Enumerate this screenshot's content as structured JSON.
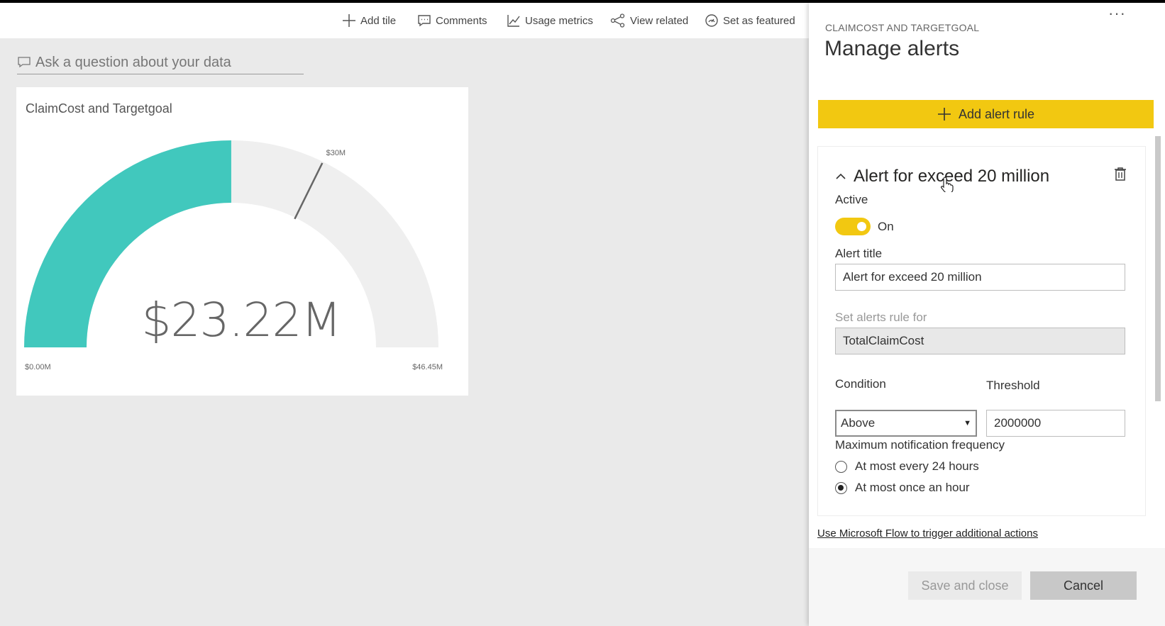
{
  "toolbar": {
    "items": [
      {
        "label": "Add tile",
        "icon": "plus-icon"
      },
      {
        "label": "Comments",
        "icon": "comment-icon"
      },
      {
        "label": "Usage metrics",
        "icon": "chart-line-icon"
      },
      {
        "label": "View related",
        "icon": "share-nodes-icon"
      },
      {
        "label": "Set as featured",
        "icon": "featured-icon"
      }
    ]
  },
  "qna": {
    "placeholder": "Ask a question about your data"
  },
  "tile": {
    "title": "ClaimCost and Targetgoal",
    "value_label": "$23.22M",
    "min_label": "$0.00M",
    "max_label": "$46.45M",
    "target_label": "$30M"
  },
  "chart_data": {
    "type": "gauge",
    "title": "ClaimCost and Targetgoal",
    "value": 23.22,
    "min": 0,
    "max": 46.45,
    "target": 30,
    "unit": "$M",
    "fill_color": "#41c8bd",
    "track_color": "#efefef"
  },
  "panel": {
    "more_label": "···",
    "subtitle": "CLAIMCOST AND TARGETGOAL",
    "title": "Manage alerts",
    "add_rule_label": "Add alert rule",
    "accent_color": "#f2c811",
    "rule": {
      "header": "Alert for exceed 20 million",
      "active_label": "Active",
      "toggle_state": "On",
      "alert_title_label": "Alert title",
      "alert_title_value": "Alert for exceed 20 million",
      "rule_for_label": "Set alerts rule for",
      "rule_for_value": "TotalClaimCost",
      "condition_label": "Condition",
      "condition_value": "Above",
      "threshold_label": "Threshold",
      "threshold_value": "2000000",
      "frequency_label": "Maximum notification frequency",
      "frequency_options": [
        {
          "label": "At most every 24 hours",
          "checked": false
        },
        {
          "label": "At most once an hour",
          "checked": true
        }
      ]
    },
    "flow_link": "Use Microsoft Flow to trigger additional actions",
    "save_label": "Save and close",
    "cancel_label": "Cancel"
  }
}
